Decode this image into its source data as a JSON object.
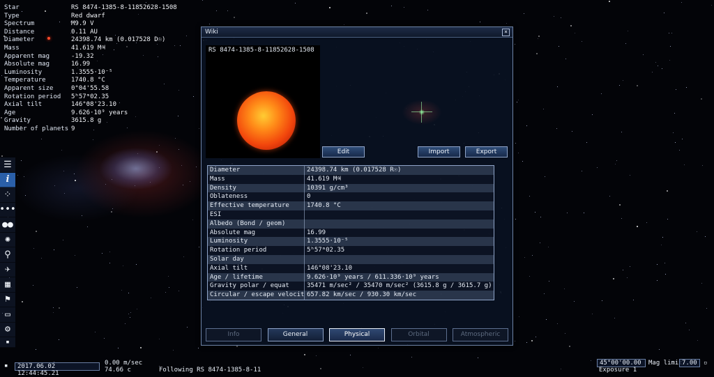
{
  "star_info": {
    "rows": [
      {
        "label": "Star",
        "value": "RS 8474-1385-8-11852628-1508"
      },
      {
        "label": "Type",
        "value": "Red dwarf"
      },
      {
        "label": "Spectrum",
        "value": "M9.9 V"
      },
      {
        "label": "Distance",
        "value": "0.11 AU"
      },
      {
        "label": "Diameter",
        "value": "24398.74 km (0.017528 D☉)"
      },
      {
        "label": "Mass",
        "value": "41.619 M♃"
      },
      {
        "label": "Apparent mag",
        "value": "-19.32"
      },
      {
        "label": "Absolute mag",
        "value": "16.99"
      },
      {
        "label": "Luminosity",
        "value": "1.3555·10⁻⁵"
      },
      {
        "label": "Temperature",
        "value": "1740.8 °C"
      },
      {
        "label": "Apparent size",
        "value": "0°04'55.58"
      },
      {
        "label": "Rotation period",
        "value": "5ʰ57ᵐ02.35"
      },
      {
        "label": "Axial tilt",
        "value": "146°08'23.10"
      },
      {
        "label": "Age",
        "value": "9.626·10⁹ years"
      },
      {
        "label": "Gravity",
        "value": "3615.8 g"
      },
      {
        "label": "Number of planets",
        "value": "9"
      }
    ]
  },
  "toolbar": {
    "icons": [
      "menu-icon",
      "info-icon",
      "star-browser-icon",
      "comet-icon",
      "planets-icon",
      "galaxy-icon",
      "search-icon",
      "ship-icon",
      "calendar-icon",
      "flag-icon",
      "display-icon",
      "settings-icon",
      "small-square-icon"
    ],
    "info_glyph": "i"
  },
  "wiki": {
    "title": "Wiki",
    "close_glyph": "×",
    "object_name": "RS 8474-1385-8-11852628-1508",
    "buttons": {
      "edit": "Edit",
      "import": "Import",
      "export": "Export"
    },
    "properties": [
      {
        "label": "Diameter",
        "value": "24398.74 km (0.017528 R☉)"
      },
      {
        "label": "Mass",
        "value": "41.619 M♃"
      },
      {
        "label": "Density",
        "value": "10391 g/cm³"
      },
      {
        "label": "Oblateness",
        "value": "0"
      },
      {
        "label": "Effective temperature",
        "value": "1740.8 °C"
      },
      {
        "label": "ESI",
        "value": ""
      },
      {
        "label": "Albedo (Bond / geom)",
        "value": ""
      },
      {
        "label": "Absolute mag",
        "value": "16.99"
      },
      {
        "label": "Luminosity",
        "value": "1.3555·10⁻⁵"
      },
      {
        "label": "Rotation period",
        "value": "5ʰ57ᵐ02.35"
      },
      {
        "label": "Solar day",
        "value": ""
      },
      {
        "label": "Axial tilt",
        "value": "146°08'23.10"
      },
      {
        "label": "Age / lifetime",
        "value": "9.626·10⁹ years / 611.336·10⁹ years"
      },
      {
        "label": "Gravity polar / equat",
        "value": "35471 m/sec² / 35470 m/sec² (3615.8 g / 3615.7 g)"
      },
      {
        "label": "Circular / escape velocity",
        "value": "657.82 km/sec / 930.30 km/sec"
      }
    ],
    "tabs": [
      {
        "label": "Info",
        "state": "disabled"
      },
      {
        "label": "General",
        "state": "enabled"
      },
      {
        "label": "Physical",
        "state": "selected"
      },
      {
        "label": "Orbital",
        "state": "disabled"
      },
      {
        "label": "Atmospheric",
        "state": "disabled"
      }
    ]
  },
  "status_bar": {
    "datetime": "2017.06.02 12:44:45.21",
    "speed_1": "0.00 m/sec",
    "speed_2": "74.66 c",
    "following": "Following RS 8474-1385-8-11",
    "fov": "45°00'00.00",
    "mag_limit_label": "Mag limit",
    "mag_limit_value": "7.00",
    "exposure": "Exposure 1"
  }
}
